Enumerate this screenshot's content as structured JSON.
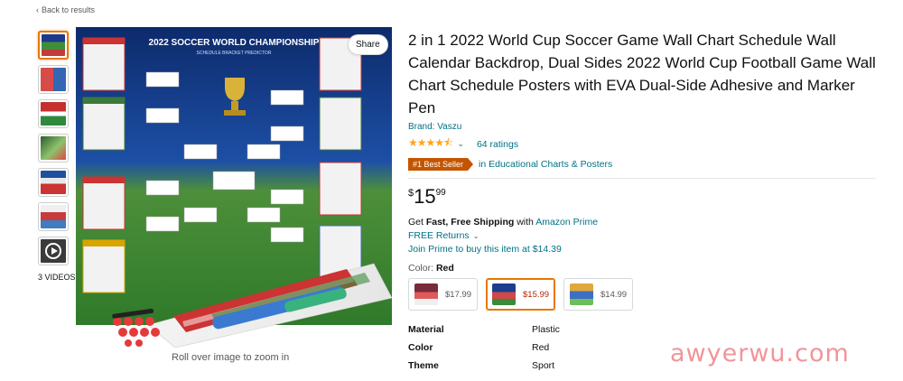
{
  "nav": {
    "back_label": "Back to results"
  },
  "gallery": {
    "thumbnail_count": 7,
    "videos_label": "3 VIDEOS",
    "zoom_hint": "Roll over image to zoom in",
    "share_label": "Share"
  },
  "product": {
    "title": "2 in 1 2022 World Cup Soccer Game Wall Chart Schedule Wall Calendar Backdrop, Dual Sides 2022 World Cup Football Game Wall Chart Schedule Posters with EVA Dual-Side Adhesive and Marker Pen",
    "brand": "Brand: Vaszu",
    "rating_stars": "★★★★⯪",
    "rating_value": 4.5,
    "ratings_count": "64 ratings",
    "badge": "#1 Best Seller",
    "badge_category": "in Educational Charts & Posters",
    "price": {
      "symbol": "$",
      "whole": "15",
      "fraction": "99"
    },
    "shipping_prefix": "Get ",
    "shipping_bold": "Fast, Free Shipping",
    "shipping_mid": " with ",
    "shipping_link": "Amazon Prime",
    "returns": "FREE Returns",
    "join_prime": "Join Prime to buy this item at $14.39",
    "color_label": "Color: ",
    "color_value": "Red",
    "swatches": [
      {
        "price": "$17.99",
        "selected": false
      },
      {
        "price": "$15.99",
        "selected": true
      },
      {
        "price": "$14.99",
        "selected": false
      }
    ],
    "attributes": [
      {
        "key": "Material",
        "value": "Plastic"
      },
      {
        "key": "Color",
        "value": "Red"
      },
      {
        "key": "Theme",
        "value": "Sport"
      }
    ]
  },
  "poster": {
    "heading": "2022 SOCCER WORLD CHAMPIONSHIP",
    "subheading": "SCHEDULE BRACKET PREDICTOR"
  },
  "watermark": "awyerwu.com",
  "colors": {
    "link": "#007185",
    "badge": "#c45500",
    "star": "#ffa41c",
    "selected_border": "#e77600",
    "price_selected": "#b12704"
  }
}
